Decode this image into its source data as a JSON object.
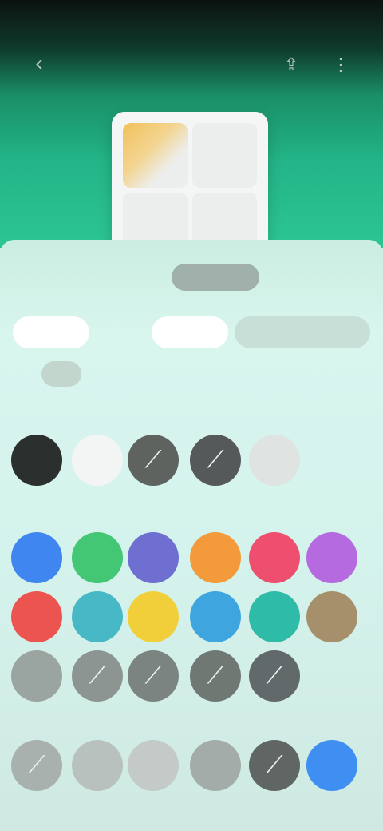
{
  "status_bar": {
    "time": "",
    "icons": ""
  },
  "header": {
    "back_icon": "arrow-left-icon",
    "action1_icon": "share-icon",
    "action2_icon": "more-icon"
  },
  "preview": {
    "caption": "",
    "side_caption": ""
  },
  "tabs": [
    {
      "label": ""
    },
    {
      "label": ""
    },
    {
      "label": ""
    },
    {
      "label": ""
    }
  ],
  "subtabs": [
    {
      "label": ""
    },
    {
      "label": ""
    }
  ],
  "sections": [
    {
      "title": ""
    },
    {
      "title": ""
    },
    {
      "title": ""
    },
    {
      "title": ""
    }
  ],
  "swatches": {
    "row1": [
      "#2b2f2d",
      "#f2f5f4",
      "#5e6360",
      "#55595a",
      "#dfe4e2"
    ],
    "row2": [
      "#3f86f0",
      "#43c774",
      "#6f6fd2",
      "#f39a3a",
      "#ee4f6e",
      "#b66ae0"
    ],
    "row3": [
      "#ec5450",
      "#47b8c6",
      "#f1cf3a",
      "#3fa5de",
      "#2ebba7",
      "#a6906b"
    ],
    "row4": [
      "#9aa5a1",
      "#8c9591",
      "#7b8480",
      "#707874",
      "#62696a"
    ],
    "row5": [
      "#a8b1ad",
      "#b9c1be",
      "#c3cac7",
      "#a3aca8",
      "#5f6664",
      "#3f8ff2"
    ]
  }
}
